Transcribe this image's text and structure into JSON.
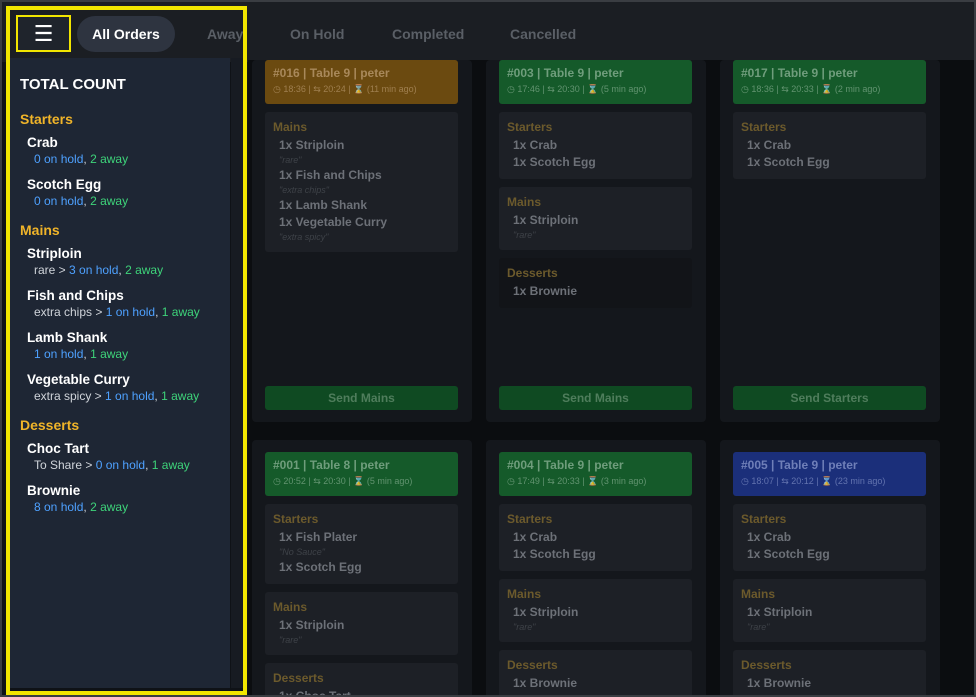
{
  "menu_button": {
    "glyph": "☰"
  },
  "tabs": [
    {
      "label": "All Orders"
    },
    {
      "label": "Away"
    },
    {
      "label": "On Hold"
    },
    {
      "label": "Completed"
    },
    {
      "label": "Cancelled"
    }
  ],
  "sidebar": {
    "title": "TOTAL COUNT",
    "categories": [
      {
        "name": "Starters",
        "items": [
          {
            "name": "Crab",
            "prefix": "",
            "hold": "0 on hold",
            "away": "2 away"
          },
          {
            "name": "Scotch Egg",
            "prefix": "",
            "hold": "0 on hold",
            "away": "2 away"
          }
        ]
      },
      {
        "name": "Mains",
        "items": [
          {
            "name": "Striploin",
            "prefix": "rare > ",
            "hold": "3 on hold",
            "away": "2 away"
          },
          {
            "name": "Fish and Chips",
            "prefix": "extra chips > ",
            "hold": "1 on hold",
            "away": "1 away"
          },
          {
            "name": "Lamb Shank",
            "prefix": "",
            "hold": "1 on hold",
            "away": "1 away"
          },
          {
            "name": "Vegetable Curry",
            "prefix": "extra spicy > ",
            "hold": "1 on hold",
            "away": "1 away"
          }
        ]
      },
      {
        "name": "Desserts",
        "items": [
          {
            "name": "Choc Tart",
            "prefix": "To Share > ",
            "hold": "0 on hold",
            "away": "1 away"
          },
          {
            "name": "Brownie",
            "prefix": "",
            "hold": "8 on hold",
            "away": "2 away"
          }
        ]
      }
    ]
  },
  "orders": [
    {
      "header": "#016 | Table 9 | peter",
      "times": "◷ 18:36 | ⇆ 20:24 | ⌛ (11 min ago)",
      "sections": [
        {
          "title": "Mains",
          "items": [
            "1x Striploin",
            "\"rare\"",
            "1x Fish and Chips",
            "\"extra chips\"",
            "1x Lamb Shank",
            "1x Vegetable Curry",
            "\"extra spicy\""
          ]
        }
      ],
      "button": "Send Mains"
    },
    {
      "header": "#003 | Table 9 | peter",
      "times": "◷ 17:46 | ⇆ 20:30 | ⌛ (5 min ago)",
      "sections": [
        {
          "title": "Starters",
          "items": [
            "1x Crab",
            "1x Scotch Egg"
          ]
        },
        {
          "title": "Mains",
          "items": [
            "1x Striploin",
            "\"rare\""
          ]
        },
        {
          "title": "Desserts",
          "items": [
            "1x Brownie"
          ]
        }
      ],
      "button": "Send Mains"
    },
    {
      "header": "#017 | Table 9 | peter",
      "times": "◷ 18:36 | ⇆ 20:33 | ⌛ (2 min ago)",
      "sections": [
        {
          "title": "Starters",
          "items": [
            "1x Crab",
            "1x Scotch Egg"
          ]
        }
      ],
      "button": "Send Starters"
    },
    {
      "header": "#001 | Table 8 | peter",
      "times": "◷ 20:52 | ⇆ 20:30 | ⌛ (5 min ago)",
      "sections": [
        {
          "title": "Starters",
          "items": [
            "1x Fish Plater",
            "\"No Sauce\"",
            "1x Scotch Egg"
          ]
        },
        {
          "title": "Mains",
          "items": [
            "1x Striploin",
            "\"rare\""
          ]
        },
        {
          "title": "Desserts",
          "items": [
            "1x Choc Tart"
          ]
        }
      ]
    },
    {
      "header": "#004 | Table 9 | peter",
      "times": "◷ 17:49 | ⇆ 20:33 | ⌛ (3 min ago)",
      "sections": [
        {
          "title": "Starters",
          "items": [
            "1x Crab",
            "1x Scotch Egg"
          ]
        },
        {
          "title": "Mains",
          "items": [
            "1x Striploin",
            "\"rare\""
          ]
        },
        {
          "title": "Desserts",
          "items": [
            "1x Brownie"
          ]
        }
      ]
    },
    {
      "header": "#005 | Table 9 | peter",
      "times": "◷ 18:07 | ⇆ 20:12 | ⌛ (23 min ago)",
      "sections": [
        {
          "title": "Starters",
          "items": [
            "1x Crab",
            "1x Scotch Egg"
          ]
        },
        {
          "title": "Mains",
          "items": [
            "1x Striploin",
            "\"rare\""
          ]
        },
        {
          "title": "Desserts",
          "items": [
            "1x Brownie"
          ]
        }
      ]
    }
  ],
  "colors": {
    "accent_yellow": "#f2e600",
    "category": "#f0b429",
    "hold": "#4ea1ff",
    "away": "#3ed37a"
  }
}
